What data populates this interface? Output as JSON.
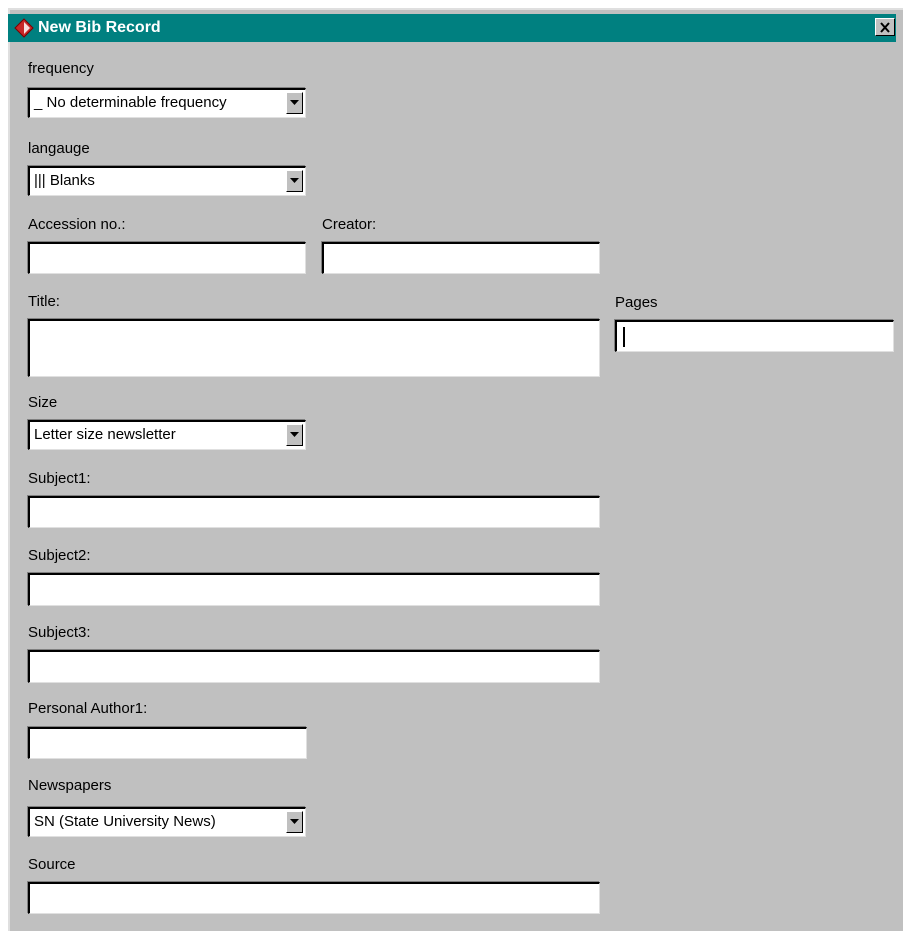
{
  "window": {
    "title": "New Bib Record"
  },
  "fields": {
    "frequency": {
      "label": "frequency",
      "value": "_   No determinable frequency"
    },
    "language": {
      "label": "langauge",
      "value": "|||   Blanks"
    },
    "accession": {
      "label": "Accession no.:",
      "value": ""
    },
    "creator": {
      "label": "Creator:",
      "value": ""
    },
    "title": {
      "label": "Title:",
      "value": ""
    },
    "pages": {
      "label": "Pages",
      "value": ""
    },
    "size": {
      "label": "Size",
      "value": "Letter size newsletter"
    },
    "subject1": {
      "label": "Subject1:",
      "value": ""
    },
    "subject2": {
      "label": "Subject2:",
      "value": ""
    },
    "subject3": {
      "label": "Subject3:",
      "value": ""
    },
    "author1": {
      "label": "Personal Author1:",
      "value": ""
    },
    "newspapers": {
      "label": "Newspapers",
      "value": "SN (State University News)"
    },
    "source": {
      "label": "Source",
      "value": ""
    }
  },
  "colors": {
    "titlebar": "#008080",
    "dialog": "#c0c0c0",
    "field": "#ffffff"
  }
}
